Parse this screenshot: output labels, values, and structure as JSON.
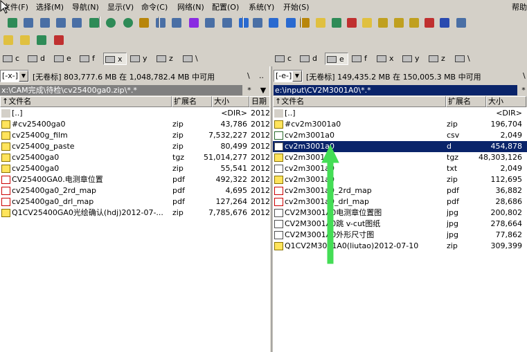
{
  "menu": [
    "文件(F)",
    "选择(M)",
    "导航(N)",
    "显示(V)",
    "命令(C)",
    "网络(N)",
    "配置(O)",
    "系统(Y)",
    "开始(S)"
  ],
  "menu_help": "帮助",
  "toolbar": {
    "row1": [
      "refresh-icon",
      "thumbnails-icon",
      "list-icon",
      "details-icon",
      "tree-icon",
      "sort-icon",
      "back-icon",
      "forward-icon",
      "pack-icon",
      "unpack-icon",
      "ftp-icon",
      "sync-icon",
      "find-icon",
      "multirename-icon",
      "compare-icon",
      "copy-names-icon",
      "edit-icon",
      "view-icon",
      "settings-icon",
      "folder-icon",
      "archive-icon",
      "checksum-icon",
      "folder2-icon",
      "package-icon",
      "package2-icon",
      "cube-icon",
      "pdf-icon",
      "word-icon",
      "media-icon"
    ],
    "row2": [
      "package3-icon",
      "folder3-icon",
      "excel-icon",
      "delete-icon"
    ]
  },
  "left": {
    "drives": [
      "c",
      "d",
      "e",
      "f",
      "x",
      "y",
      "z",
      "\\"
    ],
    "active_drive": "x",
    "drive_combo": "[-x-]",
    "free_info": "[无卷标]  803,777.6 MB 在 1,048,782.4 MB 中可用",
    "nav_sep": "\\",
    "nav_up": "..",
    "path": "x:\\CAM完成\\待检\\cv25400ga0.zip\\*.*",
    "star": "*",
    "columns": [
      "↑文件名",
      "扩展名",
      "大小",
      "日期"
    ],
    "files": [
      {
        "name": "[..]",
        "ext": "",
        "size": "<DIR>",
        "date": "2012",
        "icon": "up"
      },
      {
        "name": "#cv25400ga0",
        "ext": "zip",
        "size": "43,786",
        "date": "2012",
        "icon": "zip"
      },
      {
        "name": "cv25400g_film",
        "ext": "zip",
        "size": "7,532,227",
        "date": "2012",
        "icon": "zip"
      },
      {
        "name": "cv25400g_paste",
        "ext": "zip",
        "size": "80,499",
        "date": "2012",
        "icon": "zip"
      },
      {
        "name": "cv25400ga0",
        "ext": "tgz",
        "size": "51,014,277",
        "date": "2012",
        "icon": "zip"
      },
      {
        "name": "cv25400ga0",
        "ext": "zip",
        "size": "55,541",
        "date": "2012",
        "icon": "zip"
      },
      {
        "name": "CV25400GA0.电测章位置",
        "ext": "pdf",
        "size": "492,322",
        "date": "2012",
        "icon": "pdf"
      },
      {
        "name": "cv25400ga0_2rd_map",
        "ext": "pdf",
        "size": "4,695",
        "date": "2012",
        "icon": "pdf"
      },
      {
        "name": "cv25400ga0_drl_map",
        "ext": "pdf",
        "size": "127,264",
        "date": "2012",
        "icon": "pdf"
      },
      {
        "name": "Q1CV25400GA0光绘确认(hdj)2012-07-...",
        "ext": "zip",
        "size": "7,785,676",
        "date": "2012",
        "icon": "zip"
      }
    ]
  },
  "right": {
    "drives": [
      "c",
      "d",
      "e",
      "f",
      "x",
      "y",
      "z",
      "\\"
    ],
    "active_drive": "e",
    "drive_combo": "[-e-]",
    "free_info": "[无卷标]  149,435.2 MB 在 150,005.3 MB 中可用",
    "nav_sep": "\\",
    "nav_up": "..",
    "path": "e:\\input\\CV2M3001A0\\*.*",
    "star": "*",
    "columns": [
      "↑文件名",
      "扩展名",
      "大小"
    ],
    "files": [
      {
        "name": "[..]",
        "ext": "",
        "size": "<DIR>",
        "icon": "up"
      },
      {
        "name": "#cv2m3001a0",
        "ext": "zip",
        "size": "196,704",
        "icon": "zip"
      },
      {
        "name": "cv2m3001a0",
        "ext": "csv",
        "size": "2,049",
        "icon": "csv"
      },
      {
        "name": "cv2m3001a0",
        "ext": "d",
        "size": "454,878",
        "icon": "file"
      },
      {
        "name": "cv2m3001a0",
        "ext": "tgz",
        "size": "48,303,126",
        "icon": "zip"
      },
      {
        "name": "cv2m3001a0",
        "ext": "txt",
        "size": "2,049",
        "icon": "txt"
      },
      {
        "name": "cv2m3001a0",
        "ext": "zip",
        "size": "112,695",
        "icon": "zip"
      },
      {
        "name": "cv2m3001a0_2rd_map",
        "ext": "pdf",
        "size": "36,882",
        "icon": "pdf"
      },
      {
        "name": "cv2m3001a0_drl_map",
        "ext": "pdf",
        "size": "28,686",
        "icon": "pdf"
      },
      {
        "name": "CV2M3001A0电测章位置图",
        "ext": "jpg",
        "size": "200,802",
        "icon": "jpg"
      },
      {
        "name": "CV2M3001A0跳 v-cut图纸",
        "ext": "jpg",
        "size": "278,664",
        "icon": "jpg"
      },
      {
        "name": "CV2M3001A0外形尺寸图",
        "ext": "jpg",
        "size": "77,862",
        "icon": "jpg"
      },
      {
        "name": "Q1CV2M3001A0(liutao)2012-07-10",
        "ext": "zip",
        "size": "309,399",
        "icon": "zip"
      }
    ],
    "selected_index": 3
  },
  "colors": {
    "selection": "#0a246a",
    "path_active": "#0a246a",
    "path_inactive": "#808080",
    "annotation_arrow": "#44dd55"
  }
}
